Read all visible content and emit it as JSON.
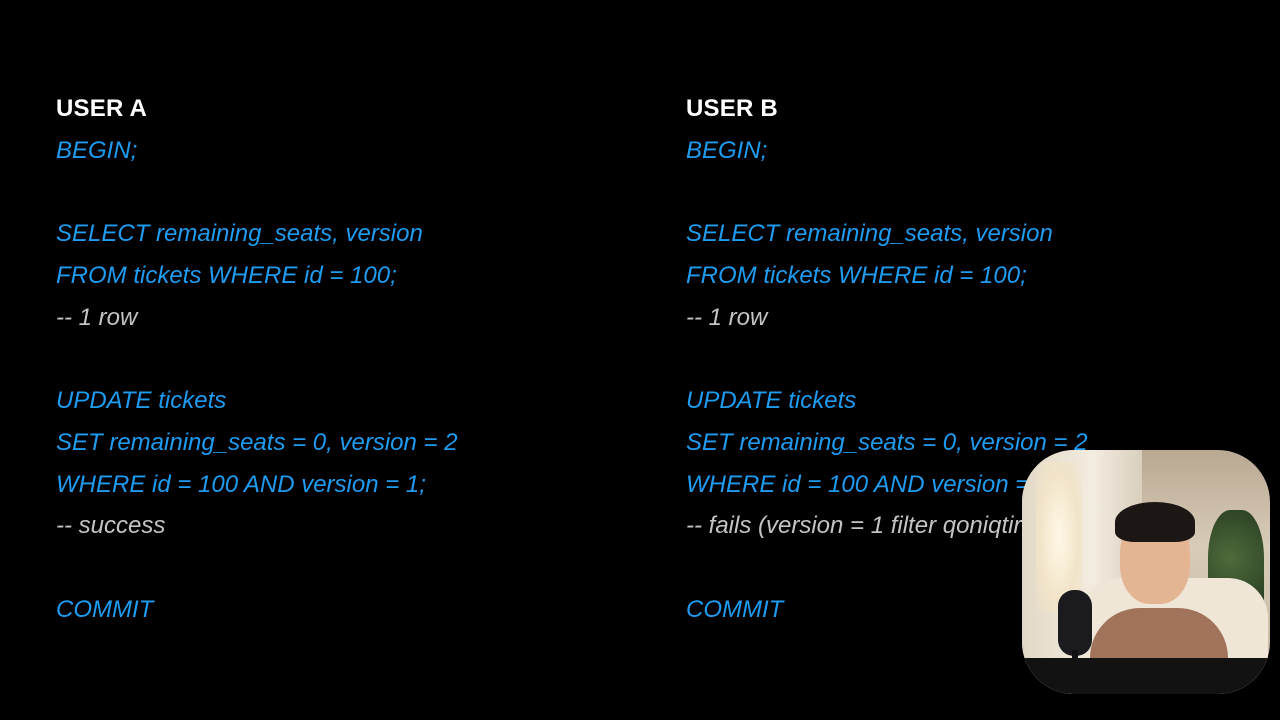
{
  "user_a": {
    "heading": "USER A",
    "lines": [
      {
        "text": "BEGIN;",
        "kind": "code"
      },
      {
        "text": "",
        "kind": "blank"
      },
      {
        "text": "SELECT remaining_seats, version",
        "kind": "code"
      },
      {
        "text": "FROM tickets WHERE id = 100;",
        "kind": "code"
      },
      {
        "text": "-- 1 row",
        "kind": "comment"
      },
      {
        "text": "",
        "kind": "blank"
      },
      {
        "text": "UPDATE tickets",
        "kind": "code"
      },
      {
        "text": "SET remaining_seats = 0, version = 2",
        "kind": "code"
      },
      {
        "text": "WHERE id = 100 AND version = 1;",
        "kind": "code"
      },
      {
        "text": "-- success",
        "kind": "comment"
      },
      {
        "text": "",
        "kind": "blank"
      },
      {
        "text": "COMMIT",
        "kind": "code"
      }
    ]
  },
  "user_b": {
    "heading": "USER B",
    "lines": [
      {
        "text": "BEGIN;",
        "kind": "code"
      },
      {
        "text": "",
        "kind": "blank"
      },
      {
        "text": "SELECT remaining_seats, version",
        "kind": "code"
      },
      {
        "text": "FROM tickets WHERE id = 100;",
        "kind": "code"
      },
      {
        "text": "-- 1 row",
        "kind": "comment"
      },
      {
        "text": "",
        "kind": "blank"
      },
      {
        "text": "UPDATE tickets",
        "kind": "code"
      },
      {
        "text": "SET remaining_seats = 0, version = 2",
        "kind": "code"
      },
      {
        "text": "WHERE id = 100 AND version = 1;",
        "kind": "code"
      },
      {
        "text": "-- fails (version = 1 filter qoniqtirmadi)",
        "kind": "comment"
      },
      {
        "text": "",
        "kind": "blank"
      },
      {
        "text": "COMMIT",
        "kind": "code"
      }
    ]
  },
  "colors": {
    "background": "#000000",
    "heading": "#ffffff",
    "code": "#1f9bf0",
    "comment": "#c4c4c4"
  }
}
